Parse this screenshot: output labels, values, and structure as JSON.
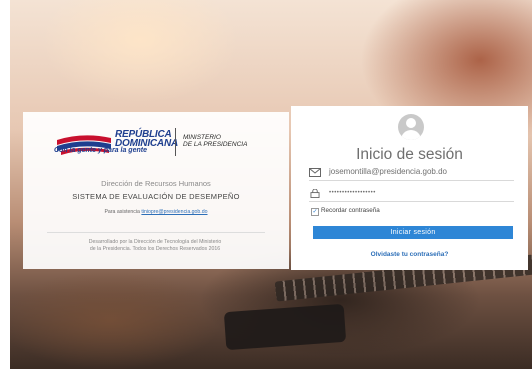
{
  "colors": {
    "brand_blue": "#1f3f8f",
    "button_blue": "#2e86d6",
    "link_blue": "#2d6fb8"
  },
  "left_panel": {
    "brand_line1": "REPÚBLICA",
    "brand_line2": "DOMINICANA",
    "tagline": "Con la gente y para la gente",
    "ministry_line1": "MINISTERIO",
    "ministry_line2": "DE LA PRESIDENCIA",
    "department": "Dirección de Recursos Humanos",
    "system_name": "SISTEMA DE EVALUACIÓN DE DESEMPEÑO",
    "assist_label": "Para asistencia",
    "assist_email": "tiniopre@presidencia.gob.do",
    "footer_line1": "Desarrollado por la Dirección de Tecnología del Ministerio",
    "footer_line2": "de la Presidencia. Todos los Derechos Reservados 2016"
  },
  "login": {
    "title": "Inicio de sesión",
    "email_value": "josemontilla@presidencia.gob.do",
    "email_icon": "envelope-icon",
    "password_value": "••••••••••••••••••",
    "password_icon": "lock-icon",
    "remember_label": "Recordar contraseña",
    "remember_checked": true,
    "submit_label": "Iniciar sesión",
    "forgot_label": "Olvidaste tu contraseña?"
  }
}
